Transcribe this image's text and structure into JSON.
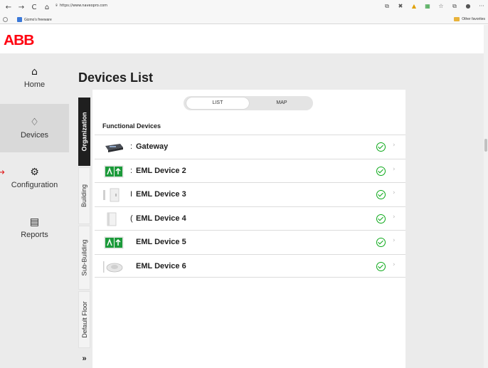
{
  "browser": {
    "back": "←",
    "forward": "→",
    "reload": "C",
    "home": "⌂",
    "url": "https://www.naveopro.com",
    "bookmark_label": "Gizmo's freeware",
    "other_favorites": "Other favorites",
    "ext_icons": [
      "tab-icon",
      "extension-icon",
      "warning-icon",
      "grid-icon",
      "favorite-star-icon",
      "collections-icon",
      "profile-icon",
      "more-icon"
    ]
  },
  "app": {
    "logo": "ABB"
  },
  "sidebar": {
    "items": [
      {
        "label": "Home",
        "icon": "home-icon",
        "glyph": "⌂"
      },
      {
        "label": "Devices",
        "icon": "lightbulb-icon",
        "glyph": "♢"
      },
      {
        "label": "Configuration",
        "icon": "gears-icon",
        "glyph": "⚙"
      },
      {
        "label": "Reports",
        "icon": "report-icon",
        "glyph": "▤"
      }
    ],
    "active": "Devices"
  },
  "main": {
    "title": "Devices List",
    "toggle": {
      "list": "LIST",
      "map": "MAP",
      "selected": "LIST"
    },
    "vertical_tabs": [
      "Organization",
      "Building",
      "Sub-Building",
      "Default Floor"
    ],
    "vertical_tabs_more": "»",
    "section_title": "Functional Devices",
    "devices": [
      {
        "prefix": ":",
        "name": "Gateway",
        "status": "ok"
      },
      {
        "prefix": ":",
        "name": "EML Device 2",
        "status": "ok"
      },
      {
        "prefix": "I",
        "name": "EML Device 3",
        "status": "ok"
      },
      {
        "prefix": "(",
        "name": "EML Device 4",
        "status": "ok"
      },
      {
        "prefix": "",
        "name": "EML Device 5",
        "status": "ok"
      },
      {
        "prefix": "",
        "name": "EML Device 6",
        "status": "ok"
      }
    ]
  },
  "colors": {
    "brand_red": "#ff000f",
    "status_green": "#0ca919",
    "sidebar_bg": "#ebebeb",
    "active_tab": "#1f1f1f"
  }
}
